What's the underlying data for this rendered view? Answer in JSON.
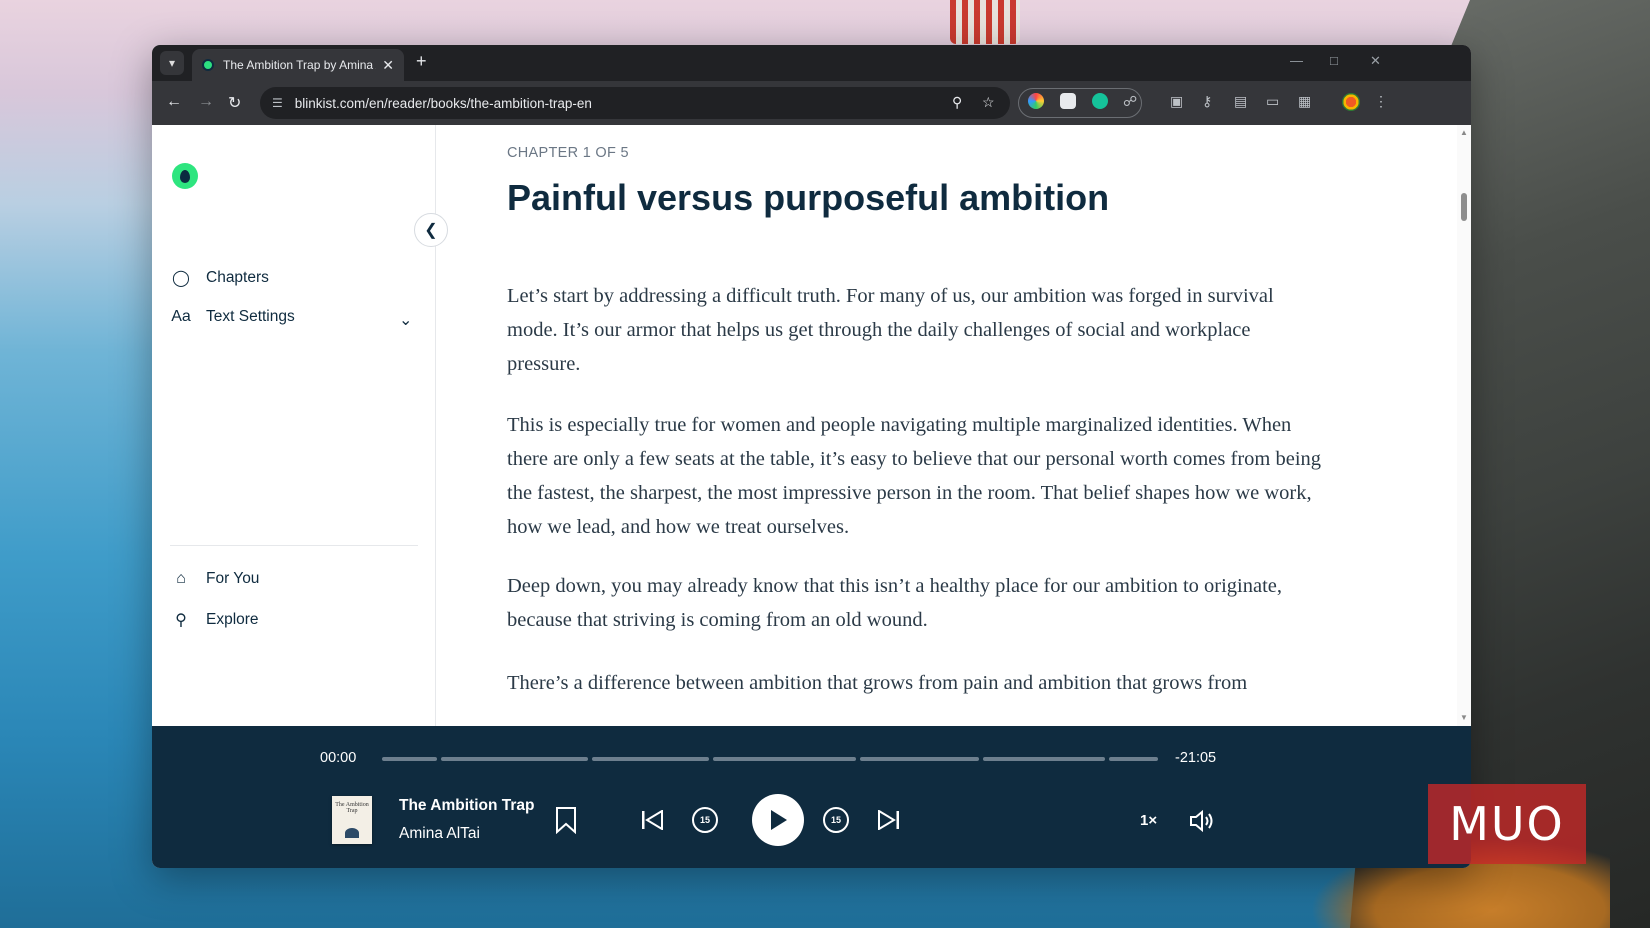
{
  "browser": {
    "tab_title": "The Ambition Trap by Amina Al",
    "url": "blinkist.com/en/reader/books/the-ambition-trap-en",
    "icons": [
      "tab-menu-icon",
      "close-icon",
      "plus-icon",
      "back-icon",
      "forward-icon",
      "reload-icon",
      "site-info-icon",
      "zoom-icon",
      "star-icon",
      "extension-icon",
      "profile-avatar",
      "kebab-menu-icon"
    ]
  },
  "sidebar": {
    "items": [
      {
        "label": "Chapters",
        "icon": "lightbulb-icon"
      },
      {
        "label": "Text Settings",
        "icon": "text-size-icon"
      }
    ],
    "nav": [
      {
        "label": "For You",
        "icon": "home-icon"
      },
      {
        "label": "Explore",
        "icon": "search-icon"
      }
    ],
    "text_icon_glyph": "Aa"
  },
  "reader": {
    "chapter_label": "CHAPTER 1 OF 5",
    "title": "Painful versus purposeful ambition",
    "paragraphs": [
      "Let’s start by addressing a difficult truth. For many of us, our ambition was forged in survival mode. It’s our armor that helps us get through the daily challenges of social and workplace pressure.",
      "This is especially true for women and people navigating multiple marginalized identities. When there are only a few seats at the table, it’s easy to believe that our personal worth comes from being the fastest, the sharpest, the most impressive person in the room. That belief shapes how we work, how we lead, and how we treat ourselves.",
      "Deep down, you may already know that this isn’t a healthy place for our ambition to originate, because that striving is coming from an old wound.",
      "There’s a difference between ambition that grows from pain and ambition that grows from"
    ]
  },
  "player": {
    "elapsed": "00:00",
    "remaining": "-21:05",
    "chapter_progress": [
      0,
      0,
      0,
      0,
      0,
      0,
      0
    ],
    "book_title": "The Ambition Trap",
    "author": "Amina AlTai",
    "cover_text": "The Ambition Trap",
    "skip_back": "15",
    "skip_forward": "15",
    "speed": "1×"
  },
  "watermark": "MUO",
  "colors": {
    "accent_green": "#2ee57f",
    "navy": "#0f2b3f",
    "browser_dark": "#35363a"
  }
}
